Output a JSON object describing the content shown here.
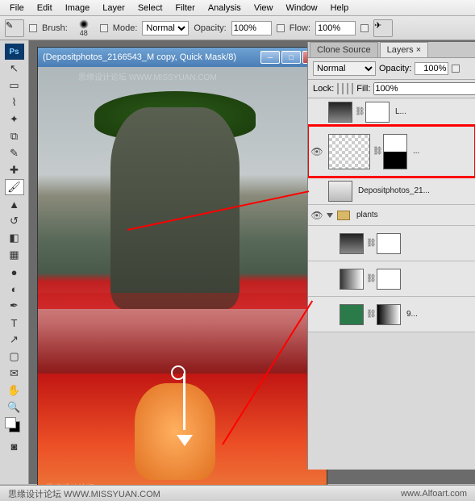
{
  "menus": [
    "File",
    "Edit",
    "Image",
    "Layer",
    "Select",
    "Filter",
    "Analysis",
    "View",
    "Window",
    "Help"
  ],
  "optbar": {
    "brush_label": "Brush:",
    "brush_size": "48",
    "mode_label": "Mode:",
    "mode_value": "Normal",
    "opacity_label": "Opacity:",
    "opacity_value": "100%",
    "flow_label": "Flow:",
    "flow_value": "100%"
  },
  "doc": {
    "title": "(Depositphotos_2166543_M copy, Quick Mask/8)"
  },
  "panel": {
    "tab_clone": "Clone Source",
    "tab_layers": "Layers ×",
    "blend_mode": "Normal",
    "opacity_label": "Opacity:",
    "opacity_value": "100%",
    "lock_label": "Lock:",
    "fill_label": "Fill:",
    "fill_value": "100%"
  },
  "layers": [
    {
      "name": "L...",
      "type": "adjustment",
      "mask": true
    },
    {
      "name": "...",
      "type": "smart",
      "mask": true,
      "highlighted": true
    },
    {
      "name": "Depositphotos_21...",
      "type": "bitmap",
      "mask": false
    },
    {
      "name": "plants",
      "type": "group"
    },
    {
      "name": "",
      "type": "adjustment",
      "mask": true,
      "indent": 1
    },
    {
      "name": "",
      "type": "adjustment",
      "mask": true,
      "indent": 1
    },
    {
      "name": "9...",
      "type": "bitmap",
      "mask": true,
      "indent": 1
    }
  ],
  "footer": {
    "left_watermark": "思缘设计论坛 WWW.MISSYUAN.COM",
    "right": "www.Alfoart.com"
  },
  "top_watermark": "思缘设计论坛 WWW.MISSYUAN.COM"
}
